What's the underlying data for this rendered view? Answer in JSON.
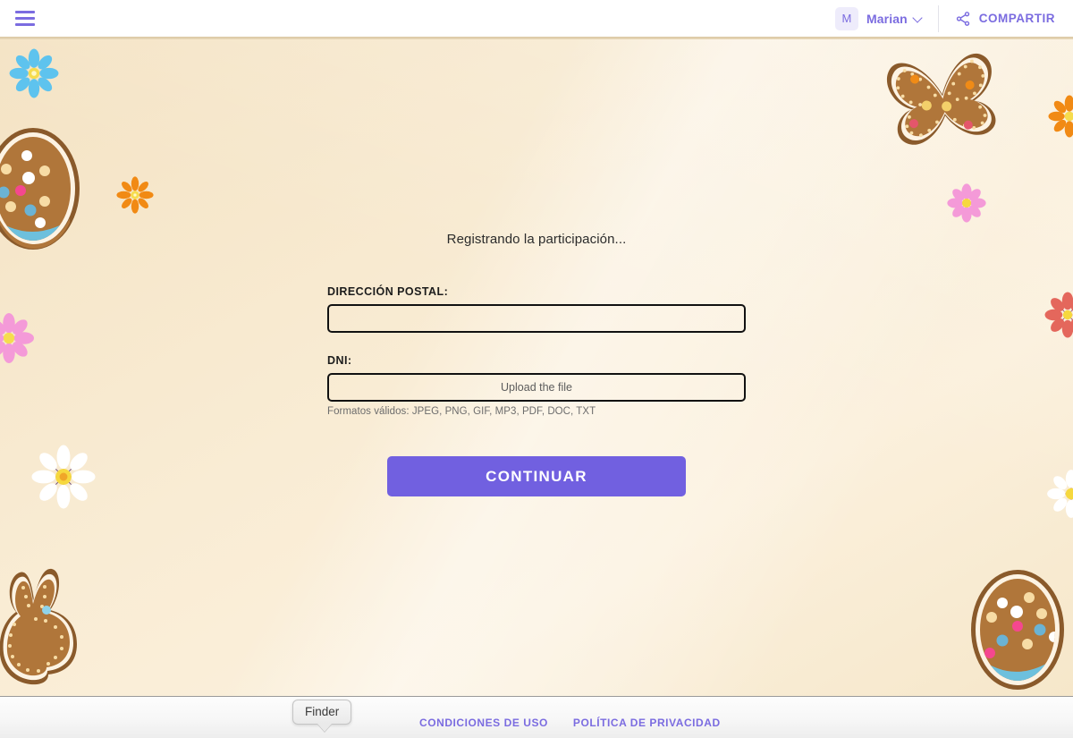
{
  "header": {
    "menu_icon": "hamburger-menu-icon",
    "avatar_initial": "M",
    "user_name": "Marian",
    "chevron_icon": "chevron-down-icon",
    "share_icon": "share-icon",
    "share_label": "COMPARTIR"
  },
  "main": {
    "status_text": "Registrando la participación...",
    "postal": {
      "label": "DIRECCIÓN POSTAL:",
      "value": "",
      "placeholder": ""
    },
    "dni": {
      "label": "DNI:",
      "upload_label": "Upload the file",
      "hint": "Formatos válidos: JPEG, PNG, GIF, MP3, PDF, DOC, TXT"
    },
    "continue_label": "CONTINUAR"
  },
  "footer": {
    "terms_label": "CONDICIONES DE USO",
    "privacy_label": "POLÍTICA DE PRIVACIDAD"
  },
  "os_tooltip": {
    "label": "Finder"
  },
  "theme": {
    "accent": "#7b6ce0",
    "button": "#7160e0",
    "background_light": "#fbf0dc",
    "background_dark": "#f4e3c4",
    "cookie_brown": "#b0763a",
    "cookie_icing": "#fdf3e3",
    "cookie_outline": "#8a5a2b"
  },
  "decorations": [
    {
      "name": "flower-blue-top-left",
      "type": "flower",
      "color": "#5ec3ee"
    },
    {
      "name": "cookie-egg-left",
      "type": "egg",
      "color": "#b0763a"
    },
    {
      "name": "flower-orange-left",
      "type": "flower",
      "color": "#f18a14"
    },
    {
      "name": "flower-pink-left-edge",
      "type": "flower",
      "color": "#f49ad8"
    },
    {
      "name": "flower-white-bottom-left",
      "type": "flower",
      "color": "#ffffff"
    },
    {
      "name": "cookie-bunny-bottom-left",
      "type": "bunny",
      "color": "#b0763a"
    },
    {
      "name": "cookie-butterfly-top-right",
      "type": "butterfly",
      "color": "#b0763a"
    },
    {
      "name": "flower-orange-right-edge",
      "type": "flower",
      "color": "#f18a14"
    },
    {
      "name": "flower-pink-right",
      "type": "flower",
      "color": "#f49ad8"
    },
    {
      "name": "flower-red-right-edge",
      "type": "flower",
      "color": "#e4675c"
    },
    {
      "name": "flower-white-right-edge",
      "type": "flower",
      "color": "#ffffff"
    },
    {
      "name": "cookie-egg-bottom-right",
      "type": "egg",
      "color": "#b0763a"
    }
  ]
}
